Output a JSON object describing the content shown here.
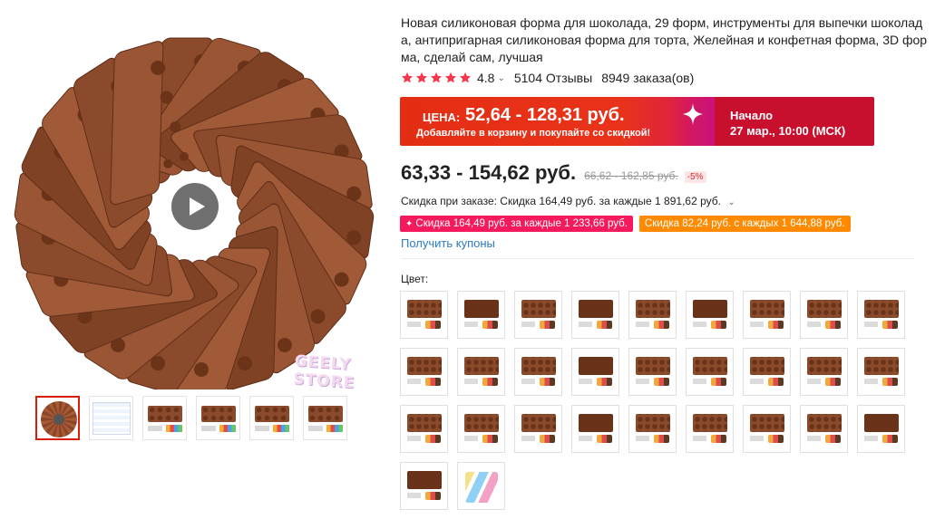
{
  "product": {
    "title": "Новая силиконовая форма для шоколада, 29 форм, инструменты для выпечки шоколада, антипригарная силиконовая форма для торта, Желейная и конфетная форма, 3D форма, сделай сам, лучшая",
    "rating": "4.8",
    "rating_stars": 5,
    "reviews": "5104 Отзывы",
    "orders": "8949 заказа(ов)"
  },
  "gallery": {
    "watermark": "GEELY STORE",
    "thumbnails": [
      {
        "kind": "round",
        "active": true
      },
      {
        "kind": "doc",
        "active": false
      },
      {
        "kind": "tray",
        "active": false
      },
      {
        "kind": "tray",
        "active": false
      },
      {
        "kind": "tray",
        "active": false
      },
      {
        "kind": "tray",
        "active": false
      }
    ],
    "icons": {
      "play": "play-icon"
    }
  },
  "promo": {
    "label": "ЦЕНА:",
    "price": "52,64 - 128,31 руб.",
    "subtitle": "Добавляйте в корзину и покупайте со скидкой!",
    "start_label": "Начало",
    "start_date": "27 мар., 10:00 (МСК)",
    "icon": "sparkle-icon"
  },
  "price": {
    "current": "63,33 - 154,62 руб.",
    "old": "66,62 - 162,85 руб.",
    "discount": "-5%"
  },
  "order_discount": {
    "text": "Скидка при заказе: Скидка 164,49 руб. за каждые 1 891,62 руб.",
    "chevron": "chevron-down-icon"
  },
  "chips": [
    {
      "text": "Скидка 164,49 руб. за каждые 1 233,66 руб.",
      "color": "#f5195e",
      "icon": "✦"
    },
    {
      "text": "Скидка 82,24 руб. с каждых 1 644,88 руб.",
      "color": "#ff8a00",
      "icon": ""
    }
  ],
  "coupons_link": "Получить купоны",
  "color_section": {
    "label": "Цвет:",
    "swatches": [
      "round",
      "square",
      "round",
      "square",
      "round",
      "square",
      "round",
      "round",
      "round",
      "round",
      "round",
      "round",
      "square",
      "round",
      "round",
      "round",
      "round",
      "round",
      "round",
      "round",
      "round",
      "square",
      "round",
      "round",
      "round",
      "round",
      "square",
      "square",
      "tools"
    ]
  },
  "colors": {
    "accent_red": "#e42e14",
    "promo_dark": "#c8102e",
    "link_blue": "#2c7bc4",
    "star": "#f5384c",
    "chocolate": "#8a4a2c"
  }
}
